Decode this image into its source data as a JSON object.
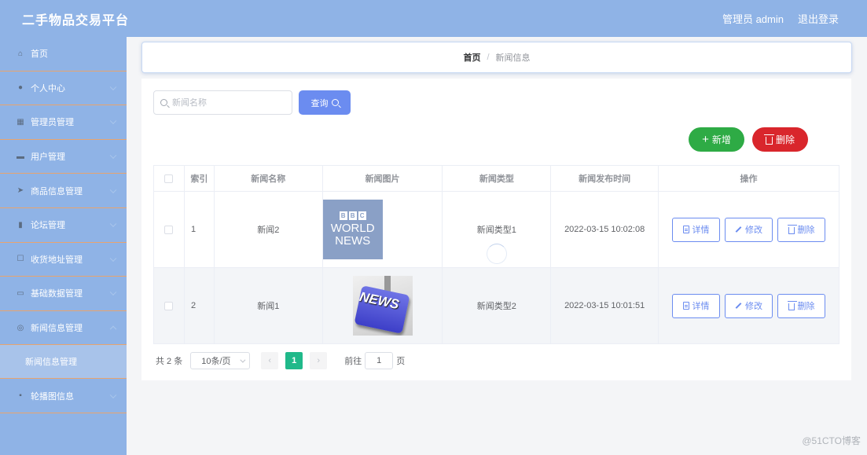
{
  "header": {
    "title": "二手物品交易平台",
    "admin_label": "管理员 admin",
    "logout_label": "退出登录"
  },
  "sidebar": {
    "items": [
      {
        "label": "首页",
        "icon": "home-icon",
        "has_children": false
      },
      {
        "label": "个人中心",
        "icon": "user-icon",
        "has_children": true
      },
      {
        "label": "管理员管理",
        "icon": "grid-icon",
        "has_children": true
      },
      {
        "label": "用户管理",
        "icon": "id-card-icon",
        "has_children": true
      },
      {
        "label": "商品信息管理",
        "icon": "send-icon",
        "has_children": true
      },
      {
        "label": "论坛管理",
        "icon": "chart-icon",
        "has_children": true
      },
      {
        "label": "收货地址管理",
        "icon": "phone-icon",
        "has_children": true
      },
      {
        "label": "基础数据管理",
        "icon": "monitor-icon",
        "has_children": true
      },
      {
        "label": "新闻信息管理",
        "icon": "compass-icon",
        "has_children": true,
        "expanded": true
      },
      {
        "label": "轮播图信息",
        "icon": "apps-icon",
        "has_children": true
      }
    ],
    "submenu": {
      "label": "新闻信息管理"
    }
  },
  "breadcrumb": {
    "home": "首页",
    "current": "新闻信息"
  },
  "search": {
    "placeholder": "新闻名称",
    "value": "",
    "button_label": "查询"
  },
  "actions": {
    "add_label": "新增",
    "delete_label": "删除"
  },
  "table": {
    "headers": [
      "索引",
      "新闻名称",
      "新闻图片",
      "新闻类型",
      "新闻发布时间",
      "操作"
    ],
    "rows": [
      {
        "index": "1",
        "name": "新闻2",
        "image": "bbc-world-news",
        "type": "新闻类型1",
        "time": "2022-03-15 10:02:08"
      },
      {
        "index": "2",
        "name": "新闻1",
        "image": "news-key",
        "type": "新闻类型2",
        "time": "2022-03-15 10:01:51"
      }
    ],
    "row_actions": {
      "detail": "详情",
      "edit": "修改",
      "delete": "删除"
    },
    "bbc_image": {
      "boxes": [
        "B",
        "B",
        "C"
      ],
      "line1": "WORLD",
      "line2": "NEWS"
    },
    "news_image": {
      "word": "NEWS"
    }
  },
  "pagination": {
    "total": "共 2 条",
    "page_size": "10条/页",
    "current_page": "1",
    "goto_prefix": "前往",
    "goto_value": "1",
    "goto_suffix": "页"
  },
  "watermark": "@51CTO博客",
  "colors": {
    "header_bg": "#8fb3e6",
    "sidebar_bg": "#8fb3e6",
    "primary": "#6b8cf0",
    "success": "#2eab45",
    "danger": "#d9262c",
    "page_active": "#20b98a",
    "menu_divider": "#e8a46e"
  }
}
